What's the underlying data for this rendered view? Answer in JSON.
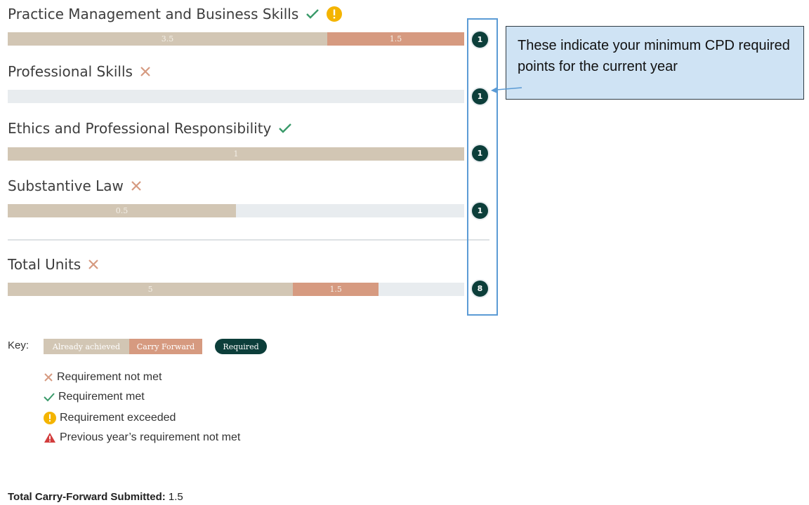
{
  "categories": [
    {
      "title": "Practice Management and Business Skills",
      "status": [
        "met",
        "exceeded"
      ],
      "achieved": 3.5,
      "carry_forward": 1.5,
      "required": "1",
      "bar_max": 5,
      "achieved_label": "3.5",
      "carry_label": "1.5"
    },
    {
      "title": "Professional Skills",
      "status": [
        "not-met"
      ],
      "achieved": 0,
      "carry_forward": 0,
      "required": "1",
      "bar_max": 1,
      "achieved_label": "",
      "carry_label": ""
    },
    {
      "title": "Ethics and Professional Responsibility",
      "status": [
        "met"
      ],
      "achieved": 1,
      "carry_forward": 0,
      "required": "1",
      "bar_max": 1,
      "achieved_label": "1",
      "carry_label": ""
    },
    {
      "title": "Substantive Law",
      "status": [
        "not-met"
      ],
      "achieved": 0.5,
      "carry_forward": 0,
      "required": "1",
      "bar_max": 1,
      "achieved_label": "0.5",
      "carry_label": ""
    }
  ],
  "total": {
    "title": "Total Units",
    "status": [
      "not-met"
    ],
    "achieved": 5,
    "carry_forward": 1.5,
    "required": "8",
    "bar_max": 8,
    "achieved_label": "5",
    "carry_label": "1.5"
  },
  "callout": {
    "text": "These indicate your minimum CPD required points for the current year"
  },
  "key": {
    "label": "Key:",
    "achieved": "Already achieved",
    "carry_forward": "Carry Forward",
    "required": "Required",
    "legend": [
      {
        "icon": "cross-icon",
        "text": "Requirement not met"
      },
      {
        "icon": "check-icon",
        "text": "Requirement met"
      },
      {
        "icon": "exclamation-circle-icon",
        "text": "Requirement exceeded"
      },
      {
        "icon": "warning-triangle-icon",
        "text": "Previous year’s requirement not met"
      }
    ]
  },
  "footer": {
    "label": "Total Carry-Forward Submitted:",
    "value": "1.5"
  },
  "colors": {
    "achieved": "#d2c6b4",
    "carry_forward": "#d69a80",
    "required": "#0c3e3a",
    "met": "#3a9a6a",
    "not_met": "#d69a80",
    "exceeded": "#f4b400",
    "warning": "#d23c3c"
  }
}
